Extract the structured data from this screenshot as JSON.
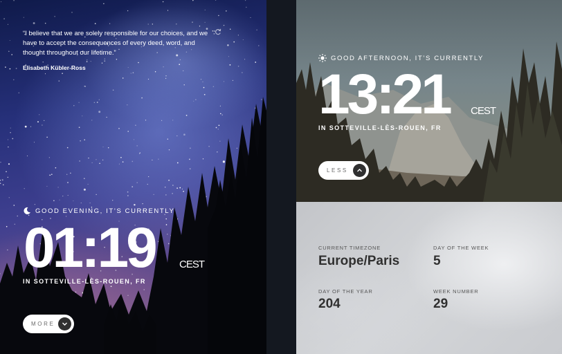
{
  "quote": {
    "text": "“I believe that we are solely responsible for our choices, and we have to accept the consequences of every deed, word, and thought throughout our lifetime.”",
    "author": "Elisabeth Kübler-Ross"
  },
  "left": {
    "greeting": "GOOD EVENING, IT’S CURRENTLY",
    "time": "01:19",
    "timezone": "CEST",
    "location": "IN SOTTEVILLE-LÈS-ROUEN, FR",
    "button_label": "MORE"
  },
  "right": {
    "greeting": "GOOD AFTERNOON, IT’S CURRENTLY",
    "time": "13:21",
    "timezone": "CEST",
    "location": "IN SOTTEVILLE-LÈS-ROUEN, FR",
    "button_label": "LESS"
  },
  "details": {
    "timezone_label": "CURRENT TIMEZONE",
    "timezone_value": "Europe/Paris",
    "day_of_week_label": "DAY OF THE WEEK",
    "day_of_week_value": "5",
    "day_of_year_label": "DAY OF THE YEAR",
    "day_of_year_value": "204",
    "week_number_label": "WEEK NUMBER",
    "week_number_value": "29"
  },
  "icons": {
    "moon": "moon-icon",
    "sun": "sun-icon",
    "refresh": "refresh-icon",
    "chevron_down": "chevron-down-icon",
    "chevron_up": "chevron-up-icon"
  }
}
